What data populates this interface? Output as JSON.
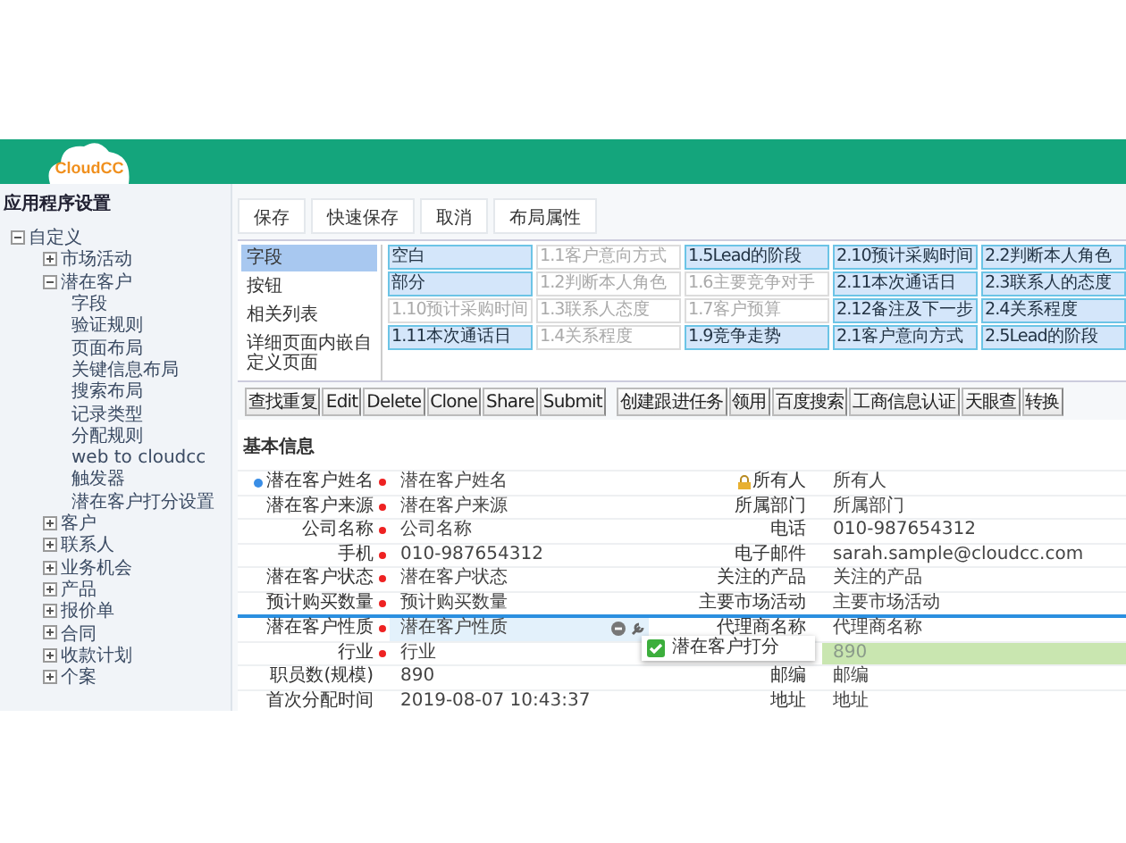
{
  "header": {
    "logo": "CloudCC"
  },
  "sidebar": {
    "title": "应用程序设置",
    "items": [
      {
        "label": "自定义",
        "expanded": true,
        "children": [
          {
            "label": "市场活动",
            "expanded": false
          },
          {
            "label": "潜在客户",
            "expanded": true,
            "children": [
              {
                "label": "字段"
              },
              {
                "label": "验证规则"
              },
              {
                "label": "页面布局"
              },
              {
                "label": "关键信息布局"
              },
              {
                "label": "搜索布局"
              },
              {
                "label": "记录类型"
              },
              {
                "label": "分配规则"
              },
              {
                "label": "web to cloudcc"
              },
              {
                "label": "触发器"
              },
              {
                "label": "潜在客户打分设置"
              }
            ]
          },
          {
            "label": "客户",
            "expanded": false
          },
          {
            "label": "联系人",
            "expanded": false
          },
          {
            "label": "业务机会",
            "expanded": false
          },
          {
            "label": "产品",
            "expanded": false
          },
          {
            "label": "报价单",
            "expanded": false
          },
          {
            "label": "合同",
            "expanded": false
          },
          {
            "label": "收款计划",
            "expanded": false
          },
          {
            "label": "个案",
            "expanded": false
          }
        ]
      }
    ]
  },
  "toolbar": [
    "保存",
    "快速保存",
    "取消",
    "布局属性"
  ],
  "palette": {
    "categories": [
      {
        "label": "字段",
        "selected": true
      },
      {
        "label": "按钮",
        "selected": false
      },
      {
        "label": "相关列表",
        "selected": false
      },
      {
        "label": "详细页面内嵌自定义页面",
        "selected": false
      }
    ],
    "rows": [
      [
        {
          "label": "空白",
          "used": false
        },
        {
          "label": "1.1客户意向方式",
          "used": true
        },
        {
          "label": "1.5Lead的阶段",
          "used": false
        },
        {
          "label": "2.10预计采购时间",
          "used": false
        },
        {
          "label": "2.2判断本人角色",
          "used": false
        }
      ],
      [
        {
          "label": "部分",
          "used": false
        },
        {
          "label": "1.2判断本人角色",
          "used": true
        },
        {
          "label": "1.6主要竞争对手",
          "used": true
        },
        {
          "label": "2.11本次通话日",
          "used": false
        },
        {
          "label": "2.3联系人的态度",
          "used": false
        }
      ],
      [
        {
          "label": "1.10预计采购时间",
          "used": true
        },
        {
          "label": "1.3联系人态度",
          "used": true
        },
        {
          "label": "1.7客户预算",
          "used": true
        },
        {
          "label": "2.12备注及下一步",
          "used": false
        },
        {
          "label": "2.4关系程度",
          "used": false
        }
      ],
      [
        {
          "label": "1.11本次通话日",
          "used": false
        },
        {
          "label": "1.4关系程度",
          "used": true
        },
        {
          "label": "1.9竞争走势",
          "used": false
        },
        {
          "label": "2.1客户意向方式",
          "used": false
        },
        {
          "label": "2.5Lead的阶段",
          "used": false
        }
      ]
    ]
  },
  "buttons": [
    [
      "查找重复",
      "Edit",
      "Delete",
      "Clone",
      "Share",
      "Submit"
    ],
    [
      "创建跟进任务",
      "领用",
      "百度搜索",
      "工商信息认证",
      "天眼查",
      "转换"
    ]
  ],
  "section": {
    "title": "基本信息"
  },
  "form_rows": [
    {
      "highlighted": false,
      "left": {
        "kind": "name",
        "label": "潜在客户姓名",
        "value": "潜在客户姓名",
        "required": true
      },
      "right": {
        "kind": "owner",
        "label": "所有人",
        "value": "所有人",
        "required": false
      }
    },
    {
      "highlighted": false,
      "left": {
        "label": "潜在客户来源",
        "value": "潜在客户来源",
        "required": true
      },
      "right": {
        "label": "所属部门",
        "value": "所属部门",
        "required": false
      }
    },
    {
      "highlighted": false,
      "left": {
        "label": "公司名称",
        "value": "公司名称",
        "required": true
      },
      "right": {
        "label": "电话",
        "value": "010-987654312",
        "required": false
      }
    },
    {
      "highlighted": false,
      "left": {
        "label": "手机",
        "value": "010-987654312",
        "required": true
      },
      "right": {
        "label": "电子邮件",
        "value": "sarah.sample@cloudcc.com",
        "required": false
      }
    },
    {
      "highlighted": false,
      "left": {
        "label": "潜在客户状态",
        "value": "潜在客户状态",
        "required": true
      },
      "right": {
        "label": "关注的产品",
        "value": "关注的产品",
        "required": false
      }
    },
    {
      "highlighted": false,
      "left": {
        "label": "预计购买数量",
        "value": "预计购买数量",
        "required": true
      },
      "right": {
        "label": "主要市场活动",
        "value": "主要市场活动",
        "required": false
      }
    },
    {
      "highlighted": true,
      "left": {
        "label": "潜在客户性质",
        "value": "潜在客户性质",
        "required": true
      },
      "right": {
        "label": "代理商名称",
        "value": "代理商名称",
        "required": false
      }
    },
    {
      "highlighted": false,
      "left": {
        "label": "行业",
        "value": "行业",
        "required": true
      },
      "right": {
        "value": "890",
        "drop_target": true
      }
    },
    {
      "highlighted": false,
      "left": {
        "label": "职员数(规模)",
        "value": "890",
        "required": false
      },
      "right": {
        "label": "邮编",
        "value": "邮编",
        "required": false
      }
    },
    {
      "highlighted": false,
      "left": {
        "label": "首次分配时间",
        "value": "2019-08-07 10:43:37",
        "required": false
      },
      "right": {
        "label": "地址",
        "value": "地址",
        "required": false
      }
    }
  ],
  "drag_item": {
    "label": "潜在客户打分"
  }
}
